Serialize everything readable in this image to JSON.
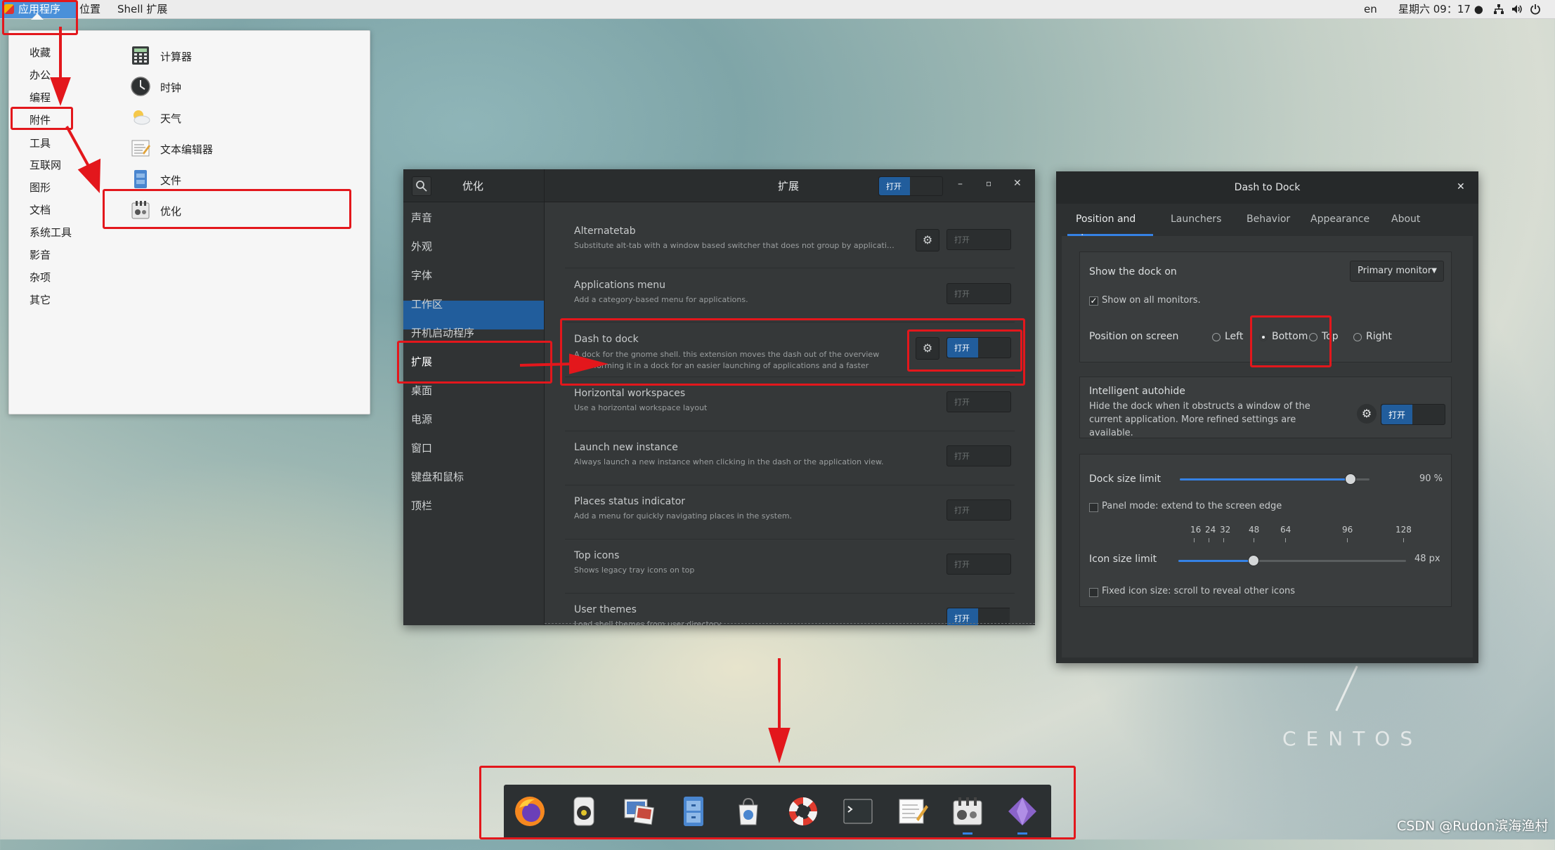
{
  "topbar": {
    "apps_label": "应用程序",
    "places_label": "位置",
    "shell_label": "Shell 扩展",
    "lang": "en",
    "datetime": "星期六 09：17 ●"
  },
  "app_menu": {
    "categories": [
      "收藏",
      "办公",
      "编程",
      "附件",
      "工具",
      "互联网",
      "图形",
      "文档",
      "系统工具",
      "影音",
      "杂项",
      "其它"
    ],
    "apps": [
      {
        "label": "计算器",
        "icon": "calculator-icon"
      },
      {
        "label": "时钟",
        "icon": "clock-icon"
      },
      {
        "label": "天气",
        "icon": "weather-icon"
      },
      {
        "label": "文本编辑器",
        "icon": "text-editor-icon"
      },
      {
        "label": "文件",
        "icon": "files-icon"
      },
      {
        "label": "优化",
        "icon": "tweaks-icon"
      }
    ]
  },
  "tweaks": {
    "sidebar_title": "优化",
    "header_title": "扩展",
    "header_switch_label": "打开",
    "sidebar_items": [
      "声音",
      "外观",
      "字体",
      "工作区",
      "开机启动程序",
      "扩展",
      "桌面",
      "电源",
      "窗口",
      "键盘和鼠标",
      "顶栏"
    ],
    "selected_sidebar": "扩展",
    "extensions": [
      {
        "name": "Alternatetab",
        "desc": "Substitute alt-tab with a window based switcher that does not group by application.",
        "gear": true,
        "enabled": false,
        "switch_label": "打开"
      },
      {
        "name": "Applications menu",
        "desc": "Add a category-based menu for applications.",
        "gear": false,
        "enabled": false,
        "switch_label": "打开"
      },
      {
        "name": "Dash to dock",
        "desc": "A dock for the gnome shell. this extension moves the dash out of the overview transforming it in a dock for an easier launching of applications and a faster switchin…",
        "gear": true,
        "enabled": true,
        "switch_label": "打开"
      },
      {
        "name": "Horizontal workspaces",
        "desc": "Use a horizontal workspace layout",
        "gear": false,
        "enabled": false,
        "switch_label": "打开"
      },
      {
        "name": "Launch new instance",
        "desc": "Always launch a new instance when clicking in the dash or the application view.",
        "gear": false,
        "enabled": false,
        "switch_label": "打开"
      },
      {
        "name": "Places status indicator",
        "desc": "Add a menu for quickly navigating places in the system.",
        "gear": false,
        "enabled": false,
        "switch_label": "打开"
      },
      {
        "name": "Top icons",
        "desc": "Shows legacy tray icons on top",
        "gear": false,
        "enabled": false,
        "switch_label": "打开"
      },
      {
        "name": "User themes",
        "desc": "Load shell themes from user directory.",
        "gear": false,
        "enabled": true,
        "switch_label": "打开"
      }
    ]
  },
  "dash_to_dock": {
    "title": "Dash to Dock",
    "tabs": [
      "Position and size",
      "Launchers",
      "Behavior",
      "Appearance",
      "About"
    ],
    "show_dock_on_label": "Show the dock on",
    "monitor_value": "Primary monitor",
    "show_all_monitors_label": "Show on all monitors.",
    "position_label": "Position on screen",
    "positions": [
      "Left",
      "Bottom",
      "Top",
      "Right"
    ],
    "selected_position": "Bottom",
    "autohide_title": "Intelligent autohide",
    "autohide_desc": "Hide the dock when it obstructs a window of the current application. More refined settings are available.",
    "autohide_switch_label": "打开",
    "dock_size_label": "Dock size limit",
    "dock_size_value": 90,
    "dock_size_text": "90 %",
    "panel_mode_label": "Panel mode: extend to the screen edge",
    "icon_size_label": "Icon size limit",
    "icon_size_marks": [
      "16",
      "24",
      "32",
      "48",
      "64",
      "96",
      "128"
    ],
    "icon_size_text": "48 px",
    "icon_size_value": 48,
    "fixed_icon_label": "Fixed icon size: scroll to reveal other icons"
  },
  "dock_icons": [
    "firefox-icon",
    "rhythmbox-icon",
    "image-viewer-icon",
    "file-cabinet-icon",
    "software-icon",
    "help-icon",
    "terminal-icon",
    "text-editor-icon",
    "tweaks-icon",
    "gem-icon"
  ],
  "branding": {
    "centos": "CENTOS"
  },
  "watermark": "CSDN @Rudon滨海渔村",
  "colors": {
    "accent": "#215d9c",
    "annotation": "#e3171c"
  }
}
